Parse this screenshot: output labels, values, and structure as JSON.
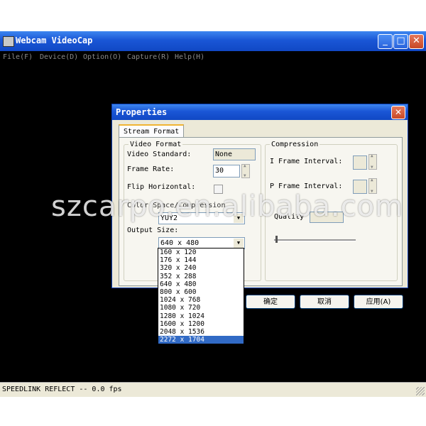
{
  "window": {
    "title": "Webcam VideoCap",
    "menu": [
      "File(F)",
      "Device(D)",
      "Option(O)",
      "Capture(R)",
      "Help(H)"
    ],
    "status": "SPEEDLINK REFLECT -- 0.0 fps"
  },
  "dialog": {
    "title": "Properties",
    "tab": "Stream Format",
    "video_format": {
      "legend": "Video Format",
      "standard_label": "Video Standard:",
      "standard_value": "None",
      "frame_rate_label": "Frame Rate:",
      "frame_rate_value": "30",
      "flip_label": "Flip Horizontal:",
      "color_space_label": "Color Space/Compression",
      "color_space_value": "YUY2",
      "output_size_label": "Output Size:",
      "output_size_value": "640 x 480"
    },
    "compression": {
      "legend": "Compression",
      "iframe_label": "I Frame Interval:",
      "pframe_label": "P Frame Interval:",
      "quality_label": "Quality"
    },
    "buttons": {
      "ok": "确定",
      "cancel": "取消",
      "apply": "应用(A)"
    },
    "size_options": [
      "160 x 120",
      "176 x 144",
      "320 x 240",
      "352 x 288",
      "640 x 480",
      "800 x 600",
      "1024 x 768",
      "1080 x 720",
      "1280 x 1024",
      "1600 x 1200",
      "2048 x 1536",
      "2272 x 1704"
    ],
    "size_selected_index": 11
  },
  "watermark": "szcarpo.en.alibaba.com",
  "colors": {
    "titlebar": "#1a56d6",
    "selection": "#316ac5",
    "dialog_bg": "#ece9d8"
  }
}
